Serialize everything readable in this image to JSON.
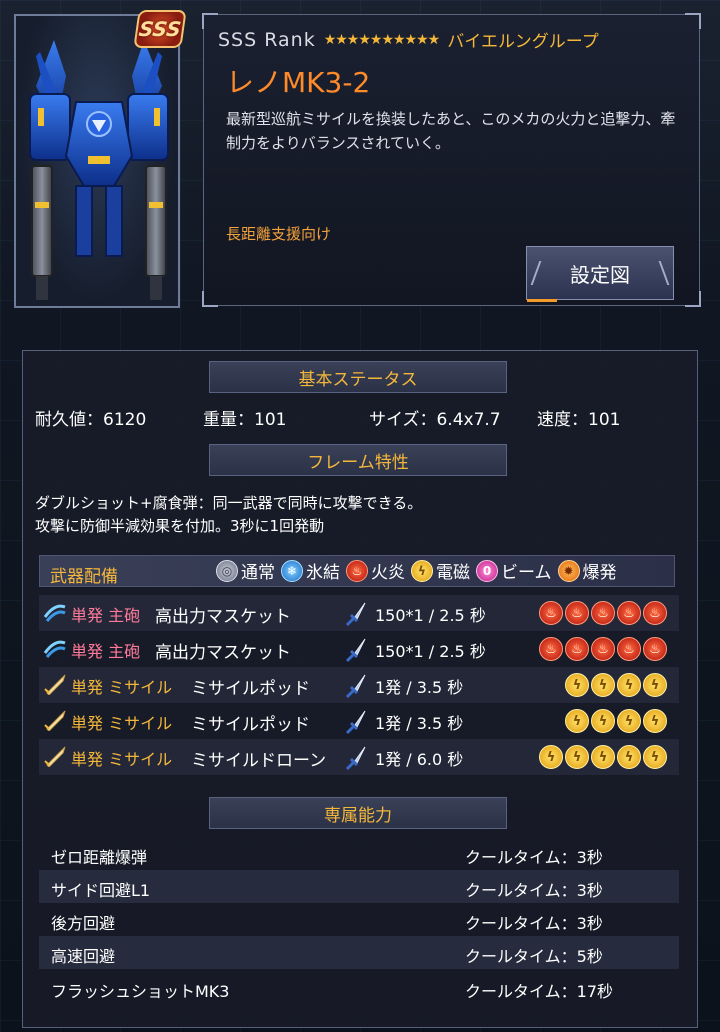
{
  "mech": {
    "rank_badge": "SSS",
    "rank_text": "SSS  Rank",
    "stars": "★★★★★★★★★★",
    "group": "バイエルングループ",
    "name": "レノMK3-2",
    "description": "最新型巡航ミサイルを換装したあと、このメカの火力と追撃力、牽制力をよりバランスされていく。",
    "role": "長距離支援向け",
    "blueprint_button": "設定図"
  },
  "basic_status": {
    "title": "基本ステータス",
    "durability": "耐久値：6120",
    "weight": "重量：101",
    "size": "サイズ：6.4x7.7",
    "speed": "速度：101"
  },
  "frame_traits": {
    "title": "フレーム特性",
    "line1": "ダブルショット+腐食弾：同一武器で同時に攻撃できる。",
    "line2": "攻撃に防御半減効果を付加。3秒に1回発動"
  },
  "weapons": {
    "title": "武器配備",
    "legend": [
      {
        "name": "通常",
        "icon": "normal"
      },
      {
        "name": "氷結",
        "icon": "ice"
      },
      {
        "name": "火炎",
        "icon": "fire"
      },
      {
        "name": "電磁",
        "icon": "electric"
      },
      {
        "name": "ビーム",
        "icon": "beam"
      },
      {
        "name": "爆発",
        "icon": "explosive"
      }
    ],
    "rows": [
      {
        "fire_type": "単発 主砲",
        "name": "高出力マスケット",
        "stats": "150*1 / 2.5 秒",
        "element": "fire",
        "level": 5
      },
      {
        "fire_type": "単発 主砲",
        "name": "高出力マスケット",
        "stats": "150*1 / 2.5 秒",
        "element": "fire",
        "level": 5
      },
      {
        "fire_type": "単発 ミサイル",
        "name": "ミサイルポッド",
        "stats": "1発 / 3.5 秒",
        "element": "electric",
        "level": 4
      },
      {
        "fire_type": "単発 ミサイル",
        "name": "ミサイルポッド",
        "stats": "1発 / 3.5 秒",
        "element": "electric",
        "level": 4
      },
      {
        "fire_type": "単発 ミサイル",
        "name": "ミサイルドローン",
        "stats": "1発 / 6.0 秒",
        "element": "electric",
        "level": 5
      }
    ]
  },
  "abilities": {
    "title": "専属能力",
    "rows": [
      {
        "name": "ゼロ距離爆弾",
        "cooldown": "クールタイム：3秒"
      },
      {
        "name": "サイド回避L1",
        "cooldown": "クールタイム：3秒"
      },
      {
        "name": "後方回避",
        "cooldown": "クールタイム：3秒"
      },
      {
        "name": "高速回避",
        "cooldown": "クールタイム：5秒"
      },
      {
        "name": "フラッシュショットMK3",
        "cooldown": "クールタイム：17秒"
      }
    ]
  },
  "colors": {
    "accent_orange": "#ff8a2a",
    "gold": "#f4b73a",
    "panel_bg": "#181c28"
  }
}
